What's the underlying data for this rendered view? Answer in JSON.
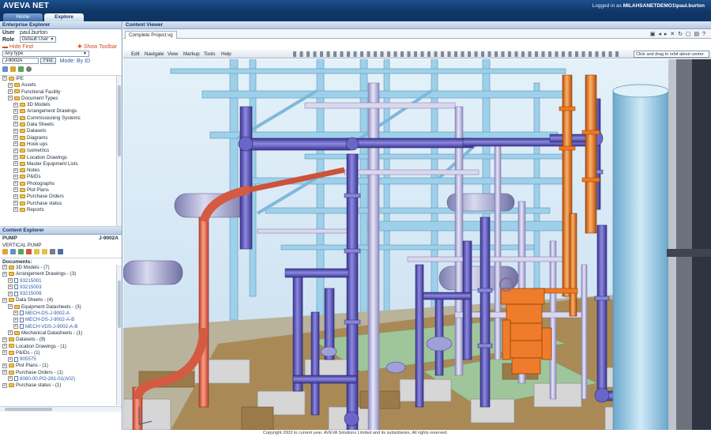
{
  "app": {
    "brand": "AVEVA NET",
    "logged_in_label": "Logged in as",
    "logged_in_user": "MILAHSANETDEMO1\\paul.burton"
  },
  "nav_tabs": [
    {
      "label": "Home"
    },
    {
      "label": "Explore"
    }
  ],
  "enterprise_explorer": {
    "title": "Enterprise Explorer",
    "user_label": "User",
    "user_value": "paul.burton",
    "role_label": "Role",
    "role_value": "Default User",
    "hide_find": "Hide Find",
    "show_toolbar": "Show Toolbar",
    "type_value": "Any type",
    "search_value": "J-9002A",
    "find_button": "Find",
    "mode_label": "Mode: By ID",
    "tree": [
      {
        "label": "IPE",
        "kind": "root",
        "indent": 0
      },
      {
        "label": "Assets",
        "kind": "folder",
        "indent": 1
      },
      {
        "label": "Functional Facility",
        "kind": "folder",
        "indent": 1
      },
      {
        "label": "Document Types",
        "kind": "folder",
        "indent": 1
      },
      {
        "label": "3D Models",
        "kind": "folder",
        "indent": 2
      },
      {
        "label": "Arrangement Drawings",
        "kind": "folder",
        "indent": 2
      },
      {
        "label": "Commissioning Systems",
        "kind": "folder",
        "indent": 2
      },
      {
        "label": "Data Sheets",
        "kind": "folder",
        "indent": 2
      },
      {
        "label": "Datasets",
        "kind": "folder",
        "indent": 2
      },
      {
        "label": "Diagrams",
        "kind": "folder",
        "indent": 2
      },
      {
        "label": "Hook ups",
        "kind": "folder",
        "indent": 2
      },
      {
        "label": "Isometrics",
        "kind": "folder",
        "indent": 2
      },
      {
        "label": "Location Drawings",
        "kind": "folder",
        "indent": 2
      },
      {
        "label": "Master Equipment Lists",
        "kind": "folder",
        "indent": 2
      },
      {
        "label": "Notes",
        "kind": "folder",
        "indent": 2
      },
      {
        "label": "P&IDs",
        "kind": "folder",
        "indent": 2
      },
      {
        "label": "Photographs",
        "kind": "folder",
        "indent": 2
      },
      {
        "label": "Plot Plans",
        "kind": "folder",
        "indent": 2
      },
      {
        "label": "Purchase Orders",
        "kind": "folder",
        "indent": 2
      },
      {
        "label": "Purchase status",
        "kind": "folder",
        "indent": 2
      },
      {
        "label": "Reports",
        "kind": "folder",
        "indent": 2
      }
    ]
  },
  "content_explorer": {
    "title": "Content Explorer",
    "object_class": "PUMP",
    "object_id": "J-9002A",
    "object_desc": "VERTICAL PUMP",
    "documents_label": "Documents:",
    "tree": [
      {
        "label": "3D Models - (7)",
        "kind": "folder",
        "indent": 0
      },
      {
        "label": "Arrangement Drawings - (3)",
        "kind": "folder",
        "indent": 0
      },
      {
        "label": "93215001",
        "kind": "doc",
        "indent": 1
      },
      {
        "label": "93215003",
        "kind": "doc",
        "indent": 1
      },
      {
        "label": "93215008",
        "kind": "doc",
        "indent": 1
      },
      {
        "label": "Data Sheets - (4)",
        "kind": "folder",
        "indent": 0
      },
      {
        "label": "Equipment Datasheets - (3)",
        "kind": "folder",
        "indent": 1
      },
      {
        "label": "MECH-DS-J-9002-A",
        "kind": "doc",
        "indent": 2
      },
      {
        "label": "MECH-DS-J-9002-A-B",
        "kind": "doc",
        "indent": 2
      },
      {
        "label": "MECH-VDS-J-9002-A-B",
        "kind": "doc",
        "indent": 2
      },
      {
        "label": "Mechanical Datasheets - (1)",
        "kind": "folder",
        "indent": 1
      },
      {
        "label": "Datasets - (9)",
        "kind": "folder",
        "indent": 0
      },
      {
        "label": "Location Drawings - (1)",
        "kind": "folder",
        "indent": 0
      },
      {
        "label": "P&IDs - (1)",
        "kind": "folder",
        "indent": 0
      },
      {
        "label": "905575",
        "kind": "doc",
        "indent": 1
      },
      {
        "label": "Plot Plans - (1)",
        "kind": "folder",
        "indent": 0
      },
      {
        "label": "Purchase Orders - (1)",
        "kind": "folder",
        "indent": 0
      },
      {
        "label": "8080-00-PO-281-01(A02)",
        "kind": "doc",
        "indent": 1
      },
      {
        "label": "Purchase status - (1)",
        "kind": "folder",
        "indent": 0
      }
    ]
  },
  "content_viewer": {
    "title": "Content Viewer",
    "tab_label": "Complete Project.vg",
    "menu": [
      "Edit",
      "Navigate",
      "View",
      "Markup",
      "Tools",
      "Help"
    ],
    "hint": "Click and drag to orbit about center."
  },
  "footer": {
    "copyright": "Copyright 2003 to current year. AVEVA Solutions Limited and its subsidiaries. All rights reserved."
  },
  "colors": {
    "brand_blue": "#0f3566",
    "pipe_purple": "#5a56b8",
    "pipe_orange": "#e8731c",
    "pipe_salmon": "#e56a4a",
    "steel_lightblue": "#9fd0ea",
    "concrete_grey": "#c9c9c9",
    "ground_green": "#9fc69a",
    "ground_brown": "#9b7a4a"
  }
}
